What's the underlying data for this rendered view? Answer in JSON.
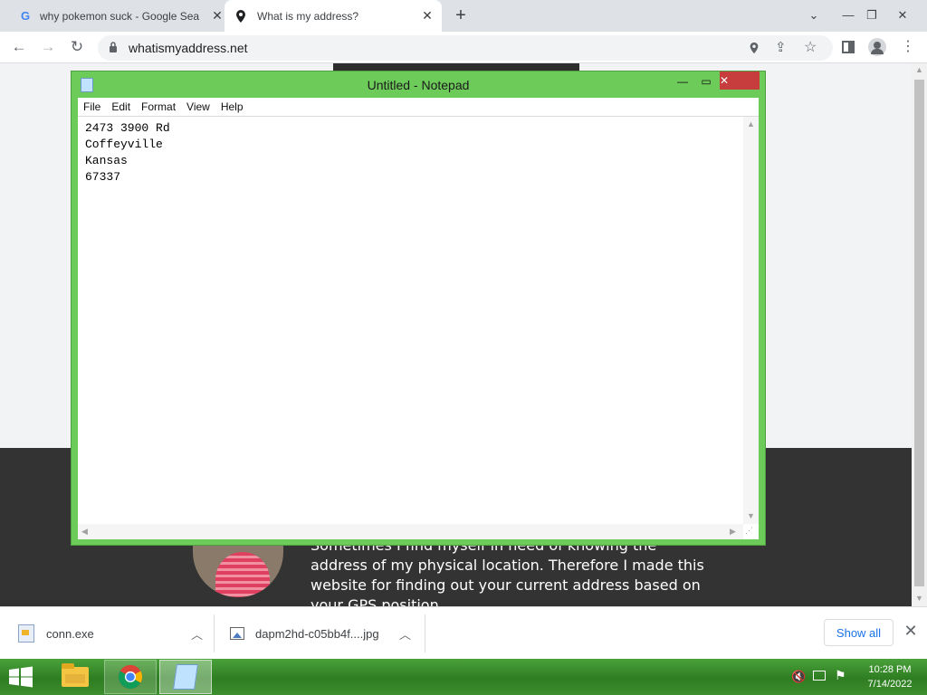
{
  "browser": {
    "tabs": [
      {
        "title": "why pokemon suck - Google Sea",
        "icon": "google-icon"
      },
      {
        "title": "What is my address?",
        "icon": "location-pin-icon",
        "active": true
      }
    ],
    "new_tab_label": "+",
    "url": "whatismyaddress.net"
  },
  "page": {
    "about_text": "Sometimes I find myself in need of knowing the address of my physical location. Therefore I made this website for finding out your current address based on your GPS position."
  },
  "notepad": {
    "title": "Untitled - Notepad",
    "menu": [
      "File",
      "Edit",
      "Format",
      "View",
      "Help"
    ],
    "content": "2473 3900 Rd\nCoffeyville\nKansas\n67337"
  },
  "downloads": {
    "items": [
      {
        "name": "conn.exe",
        "icon": "exe-file-icon"
      },
      {
        "name": "dapm2hd-c05bb4f....jpg",
        "icon": "image-file-icon"
      }
    ],
    "show_all_label": "Show all"
  },
  "taskbar": {
    "time": "10:28 PM",
    "date": "7/14/2022"
  },
  "colors": {
    "window_accent": "#6dcb5a",
    "close_button": "#c73c3c",
    "taskbar": "#3d8e2e",
    "link_blue": "#1a73e8"
  }
}
